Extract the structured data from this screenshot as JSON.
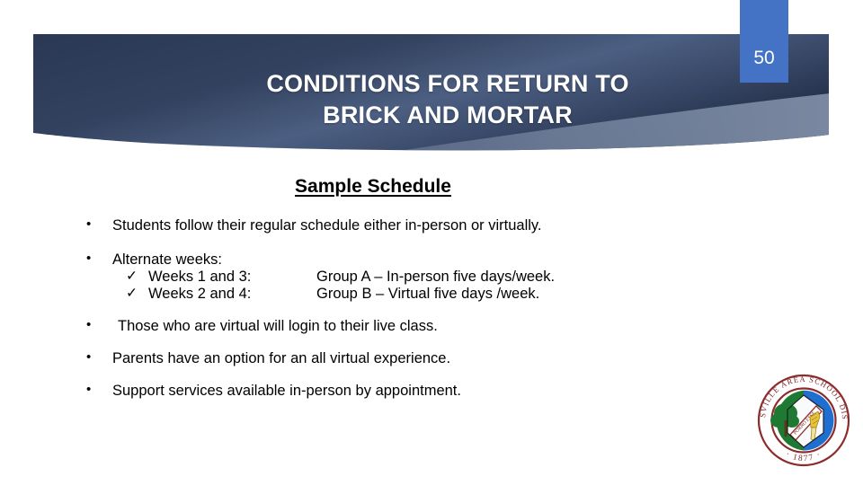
{
  "slide": {
    "title_lines": [
      "CONDITIONS FOR RETURN TO",
      "BRICK AND MORTAR"
    ],
    "slide_number": "50",
    "section_heading": "Sample Schedule",
    "bullets": [
      {
        "marker": "•",
        "text": "Students follow their regular schedule either in-person or virtually."
      },
      {
        "marker": "•",
        "text": "Alternate weeks:"
      },
      {
        "marker": "•",
        "text": "Those who are virtual will login to their live class."
      },
      {
        "marker": "•",
        "text": "Parents have an option for an all virtual experience."
      },
      {
        "marker": "•",
        "text": "Support services available in-person by appointment."
      }
    ],
    "sub_items": [
      {
        "marker": "✓",
        "label": "Weeks 1 and 3:",
        "value": "Group A – In-person five days/week."
      },
      {
        "marker": "✓",
        "label": "Weeks 2 and 4:",
        "value": "Group B – Virtual five days /week."
      }
    ]
  },
  "logo": {
    "ring_text_top": "COATESVILLE AREA SCHOOL DISTRICT",
    "year": "1877",
    "banner_text": "PORRO ESSE"
  },
  "colors": {
    "banner_dark": "#2b3a59",
    "banner_mid": "#46587a",
    "banner_light": "#7e8ca6",
    "badge_blue": "#4472c4",
    "seal_ring": "#8c2b2b",
    "seal_green": "#1e7a33",
    "seal_blue": "#1f6fd0",
    "text_black": "#000000",
    "title_white": "#ffffff"
  }
}
